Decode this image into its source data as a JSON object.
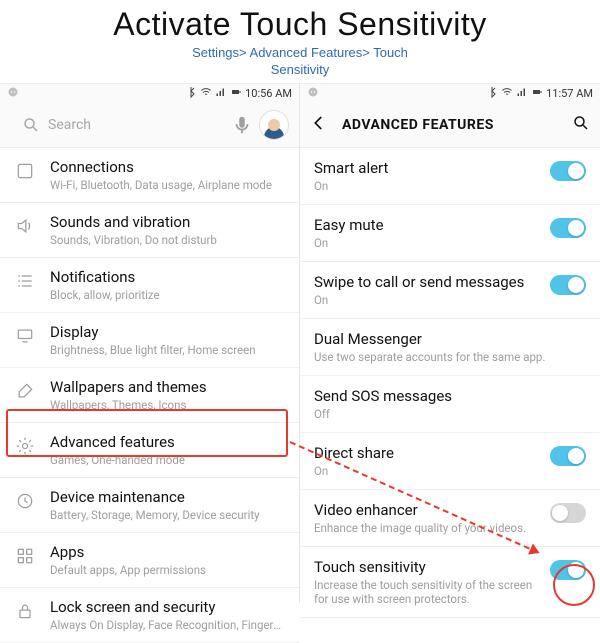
{
  "hero": {
    "title": "Activate Touch Sensitivity",
    "path_line1": "Settings> Advanced Features> Touch",
    "path_line2": "Sensitivity"
  },
  "left": {
    "status": {
      "time": "10:56 AM"
    },
    "search_placeholder": "Search",
    "items": [
      {
        "icon": "rect",
        "title": "Connections",
        "sub": "Wi-Fi, Bluetooth, Data usage, Airplane mode"
      },
      {
        "icon": "speaker",
        "title": "Sounds and vibration",
        "sub": "Sounds, Vibration, Do not disturb"
      },
      {
        "icon": "list",
        "title": "Notifications",
        "sub": "Block, allow, prioritize"
      },
      {
        "icon": "display",
        "title": "Display",
        "sub": "Brightness, Blue light filter, Home screen"
      },
      {
        "icon": "brush",
        "title": "Wallpapers and themes",
        "sub": "Wallpapers, Themes, Icons"
      },
      {
        "icon": "gear",
        "title": "Advanced features",
        "sub": "Games, One-handed mode"
      },
      {
        "icon": "care",
        "title": "Device maintenance",
        "sub": "Battery, Storage, Memory, Device security"
      },
      {
        "icon": "grid",
        "title": "Apps",
        "sub": "Default apps, App permissions"
      },
      {
        "icon": "lock",
        "title": "Lock screen and security",
        "sub": "Always On Display, Face Recognition, Fingerprints, Iris"
      }
    ]
  },
  "right": {
    "status": {
      "time": "11:57 AM"
    },
    "header": "ADVANCED FEATURES",
    "items": [
      {
        "title": "Smart alert",
        "sub": "On",
        "toggle": "on"
      },
      {
        "title": "Easy mute",
        "sub": "On",
        "toggle": "on"
      },
      {
        "title": "Swipe to call or send messages",
        "sub": "On",
        "toggle": "on"
      },
      {
        "title": "Dual Messenger",
        "sub": "Use two separate accounts for the same app.",
        "toggle": null
      },
      {
        "title": "Send SOS messages",
        "sub": "Off",
        "toggle": null
      },
      {
        "title": "Direct share",
        "sub": "On",
        "toggle": "on"
      },
      {
        "title": "Video enhancer",
        "sub": "Enhance the image quality of your videos.",
        "toggle": "off"
      },
      {
        "title": "Touch sensitivity",
        "sub": "Increase the touch sensitivity of the screen for use with screen protectors.",
        "toggle": "on"
      }
    ]
  }
}
